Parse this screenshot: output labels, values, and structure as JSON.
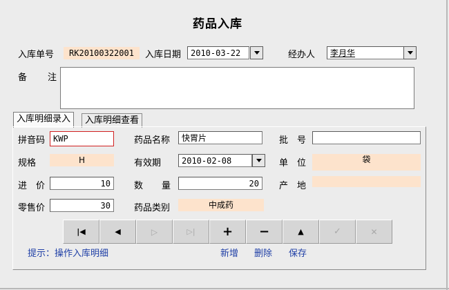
{
  "title": "药品入库",
  "header": {
    "order_no_label": "入库单号",
    "order_no_value": "RK20100322001",
    "date_label": "入库日期",
    "date_value": "2010-03-22",
    "handler_label": "经办人",
    "handler_value": "李月华",
    "remark_label_1": "备",
    "remark_label_2": "注",
    "remark_value": ""
  },
  "tabs": [
    {
      "label": "入库明细录入"
    },
    {
      "label": "入库明细查看"
    }
  ],
  "detail": {
    "pinyin_label": "拼音码",
    "pinyin_value": "KWP",
    "drug_name_label": "药品名称",
    "drug_name_value": "快胃片",
    "batch_label_1": "批",
    "batch_label_2": "号",
    "batch_value": "",
    "spec_label": "规格",
    "spec_value": "H",
    "expiry_label": "有效期",
    "expiry_value": "2010-02-08",
    "unit_label_1": "单",
    "unit_label_2": "位",
    "unit_value": "袋",
    "price_label_1": "进",
    "price_label_2": "价",
    "price_value": "10",
    "qty_label_1": "数",
    "qty_label_2": "量",
    "qty_value": "20",
    "origin_label_1": "产",
    "origin_label_2": "地",
    "origin_value": "",
    "retail_label": "零售价",
    "retail_value": "30",
    "category_label": "药品类别",
    "category_value": "中成药"
  },
  "navbar": {
    "first_glyph": "|◀",
    "prev_glyph": "◀",
    "next_glyph": "▷",
    "last_glyph": "▷|",
    "add_glyph": "+",
    "remove_glyph": "−",
    "up_glyph": "▲",
    "confirm_glyph": "✓",
    "cancel_glyph": "✕"
  },
  "footer": {
    "hint": "提示：操作入库明细",
    "add_label": "新增",
    "delete_label": "删除",
    "save_label": "保存"
  },
  "colors": {
    "readonly_bg": "#fde3cc",
    "link": "#1f3fa6",
    "focus_border": "#d11f1f"
  }
}
